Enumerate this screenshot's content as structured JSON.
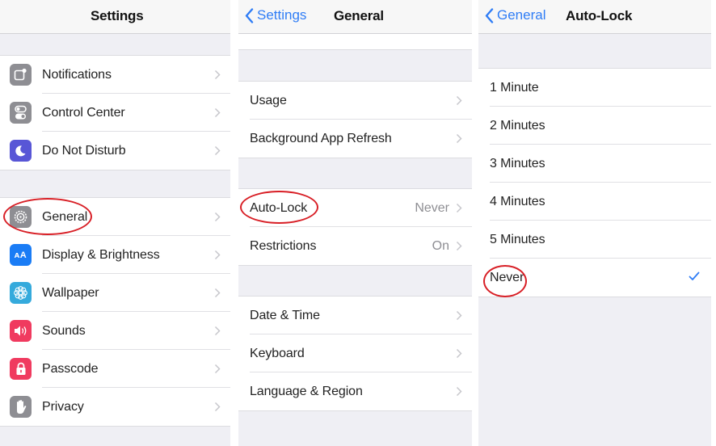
{
  "colors": {
    "accent": "#2f7df6",
    "annotation": "#d81f26",
    "grouped_background": "#efeff4",
    "cell_background": "#ffffff"
  },
  "settings_panel": {
    "title": "Settings",
    "groups": [
      [
        {
          "label": "Notifications",
          "icon": "notifications-icon",
          "icon_color": "#8e8e93"
        },
        {
          "label": "Control Center",
          "icon": "control-center-icon",
          "icon_color": "#8e8e93"
        },
        {
          "label": "Do Not Disturb",
          "icon": "moon-icon",
          "icon_color": "#5856d6"
        }
      ],
      [
        {
          "label": "General",
          "icon": "gear-icon",
          "icon_color": "#8e8e93",
          "highlighted": true
        },
        {
          "label": "Display & Brightness",
          "icon": "display-brightness-icon",
          "icon_color": "#1a7cf5"
        },
        {
          "label": "Wallpaper",
          "icon": "wallpaper-flower-icon",
          "icon_color": "#35aadc"
        },
        {
          "label": "Sounds",
          "icon": "speaker-icon",
          "icon_color": "#f03a5f"
        },
        {
          "label": "Passcode",
          "icon": "lock-icon",
          "icon_color": "#f03a5f"
        },
        {
          "label": "Privacy",
          "icon": "hand-icon",
          "icon_color": "#8e8e93"
        }
      ]
    ]
  },
  "general_panel": {
    "back_label": "Settings",
    "title": "General",
    "groups": [
      [
        {
          "label": "Usage"
        },
        {
          "label": "Background App Refresh"
        }
      ],
      [
        {
          "label": "Auto-Lock",
          "value": "Never",
          "highlighted": true
        },
        {
          "label": "Restrictions",
          "value": "On"
        }
      ],
      [
        {
          "label": "Date & Time"
        },
        {
          "label": "Keyboard"
        },
        {
          "label": "Language & Region"
        }
      ]
    ]
  },
  "autolock_panel": {
    "back_label": "General",
    "title": "Auto-Lock",
    "options": [
      {
        "label": "1 Minute",
        "selected": false
      },
      {
        "label": "2 Minutes",
        "selected": false
      },
      {
        "label": "3 Minutes",
        "selected": false
      },
      {
        "label": "4 Minutes",
        "selected": false
      },
      {
        "label": "5 Minutes",
        "selected": false
      },
      {
        "label": "Never",
        "selected": true,
        "highlighted": true
      }
    ]
  }
}
